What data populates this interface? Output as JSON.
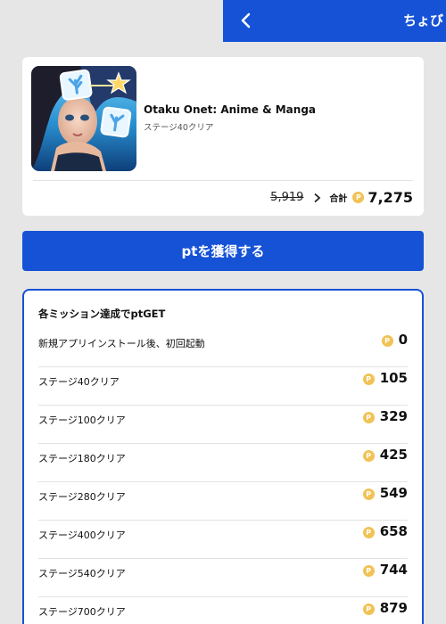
{
  "header": {
    "title": "ちょびリッチ"
  },
  "offer": {
    "app_name": "Otaku Onet: Anime & Manga",
    "condition": "ステージ40クリア",
    "old_price": "5,919",
    "total_label": "合計",
    "total_value": "7,275",
    "coin_symbol": "P"
  },
  "cta": {
    "label": "ptを獲得する"
  },
  "missions": {
    "title": "各ミッション達成でptGET",
    "items": [
      {
        "label": "新規アプリインストール後、初回起動",
        "points": "0"
      },
      {
        "label": "ステージ40クリア",
        "points": "105"
      },
      {
        "label": "ステージ100クリア",
        "points": "329"
      },
      {
        "label": "ステージ180クリア",
        "points": "425"
      },
      {
        "label": "ステージ280クリア",
        "points": "549"
      },
      {
        "label": "ステージ400クリア",
        "points": "658"
      },
      {
        "label": "ステージ540クリア",
        "points": "744"
      },
      {
        "label": "ステージ700クリア",
        "points": "879"
      }
    ]
  },
  "colors": {
    "brand_blue": "#1552d6",
    "coin": "#f1c255"
  },
  "icons": {
    "back": "chevron-left-icon",
    "more": "chevron-right-icon",
    "coin": "point-coin-icon"
  }
}
